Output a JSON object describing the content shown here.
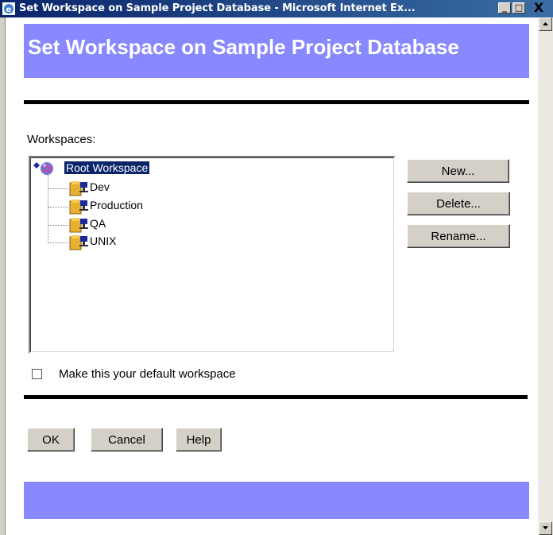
{
  "window": {
    "title": "Set Workspace on Sample Project Database - Microsoft Internet Ex...",
    "min_label": "_",
    "max_label": "□",
    "close_label": "X"
  },
  "page": {
    "heading": "Set Workspace on Sample Project Database",
    "banner_color": "#8888ff"
  },
  "workspaces": {
    "label": "Workspaces:",
    "root": {
      "label": "Root Workspace",
      "selected": true,
      "icon": "globe-icon"
    },
    "children": [
      {
        "label": "Dev",
        "icon": "workspace-folder-icon"
      },
      {
        "label": "Production",
        "icon": "workspace-folder-icon"
      },
      {
        "label": "QA",
        "icon": "workspace-folder-icon"
      },
      {
        "label": "UNIX",
        "icon": "workspace-folder-icon"
      }
    ]
  },
  "actions": {
    "new_label": "New...",
    "delete_label": "Delete...",
    "rename_label": "Rename..."
  },
  "default_checkbox": {
    "label": "Make this your default workspace",
    "checked": false
  },
  "footer": {
    "ok_label": "OK",
    "cancel_label": "Cancel",
    "help_label": "Help"
  }
}
